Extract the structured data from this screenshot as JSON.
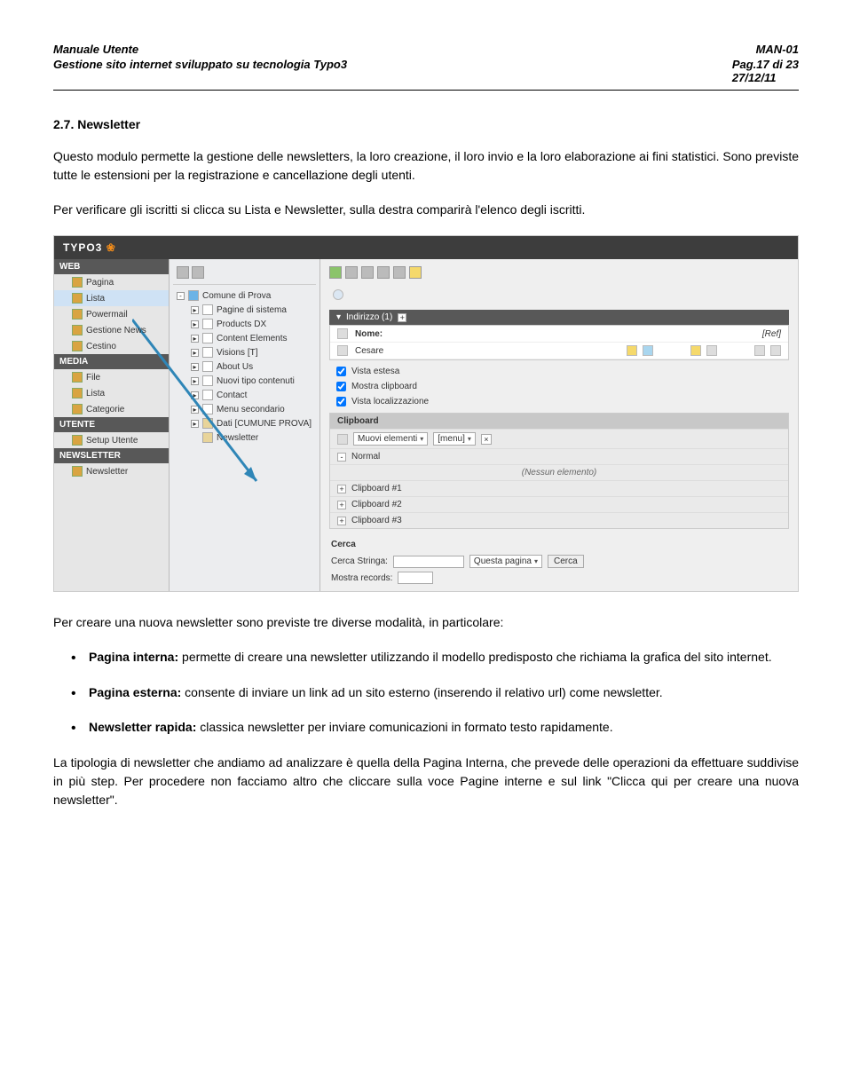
{
  "header": {
    "title_left": "Manuale Utente",
    "title_right": "MAN-01",
    "sub_left": "Gestione sito internet sviluppato su tecnologia Typo3",
    "sub_right_top": "Pag.17 di 23",
    "sub_right_bottom": "27/12/11"
  },
  "section": {
    "heading": "2.7. Newsletter",
    "para1": "Questo modulo permette la gestione delle newsletters, la loro creazione, il loro invio e la loro elaborazione ai fini statistici. Sono previste tutte le estensioni per la registrazione e cancellazione degli utenti.",
    "para2": "Per verificare gli iscritti si clicca su Lista e Newsletter, sulla destra comparirà l'elenco degli iscritti.",
    "para3": "Per creare una nuova newsletter sono previste tre diverse modalità, in particolare:",
    "bullets": [
      {
        "strong": "Pagina interna:",
        "text": " permette di creare una newsletter utilizzando il modello predisposto che richiama la grafica del sito internet."
      },
      {
        "strong": "Pagina esterna:",
        "text": " consente di inviare un link ad un sito esterno (inserendo il relativo url) come newsletter."
      },
      {
        "strong": "Newsletter rapida:",
        "text": " classica newsletter per inviare comunicazioni in formato testo rapidamente."
      }
    ],
    "para4": "La tipologia di newsletter che andiamo ad analizzare è quella della Pagina Interna, che prevede delle operazioni da effettuare suddivise in più step. Per procedere non facciamo altro che cliccare sulla voce Pagine interne e sul link \"Clicca qui per creare una nuova newsletter\"."
  },
  "shot": {
    "logo": "TYPO3",
    "nav": {
      "groups": [
        {
          "head": "WEB",
          "items": [
            "Pagina",
            "Lista",
            "Powermail",
            "Gestione News",
            "Cestino"
          ],
          "highlight_index": 1
        },
        {
          "head": "MEDIA",
          "items": [
            "File",
            "Lista",
            "Categorie"
          ]
        },
        {
          "head": "UTENTE",
          "items": [
            "Setup Utente"
          ]
        },
        {
          "head": "NEWSLETTER",
          "items": [
            "Newsletter"
          ]
        }
      ]
    },
    "tree": {
      "root": "Comune di Prova",
      "children": [
        "Pagine di sistema",
        "Products DX",
        "Content Elements",
        "Visions [T]",
        "About Us",
        "Nuovi tipo contenuti",
        "Contact",
        "Menu secondario",
        "Dati [CUMUNE PROVA]",
        "Newsletter"
      ]
    },
    "panel": {
      "title": "Indirizzo (1)",
      "name_label": "Nome:",
      "ref_label": "[Ref]",
      "row_name": "Cesare",
      "checks": [
        "Vista estesa",
        "Mostra clipboard",
        "Vista localizzazione"
      ],
      "clipboard": {
        "title": "Clipboard",
        "select1": "Muovi elementi",
        "select2": "[menu]",
        "normal": "Normal",
        "empty": "(Nessun elemento)",
        "slots": [
          "Clipboard #1",
          "Clipboard #2",
          "Clipboard #3"
        ]
      },
      "cerca": {
        "title": "Cerca",
        "label_string": "Cerca Stringa:",
        "select": "Questa pagina",
        "btn": "Cerca",
        "label_records": "Mostra records:"
      }
    }
  }
}
